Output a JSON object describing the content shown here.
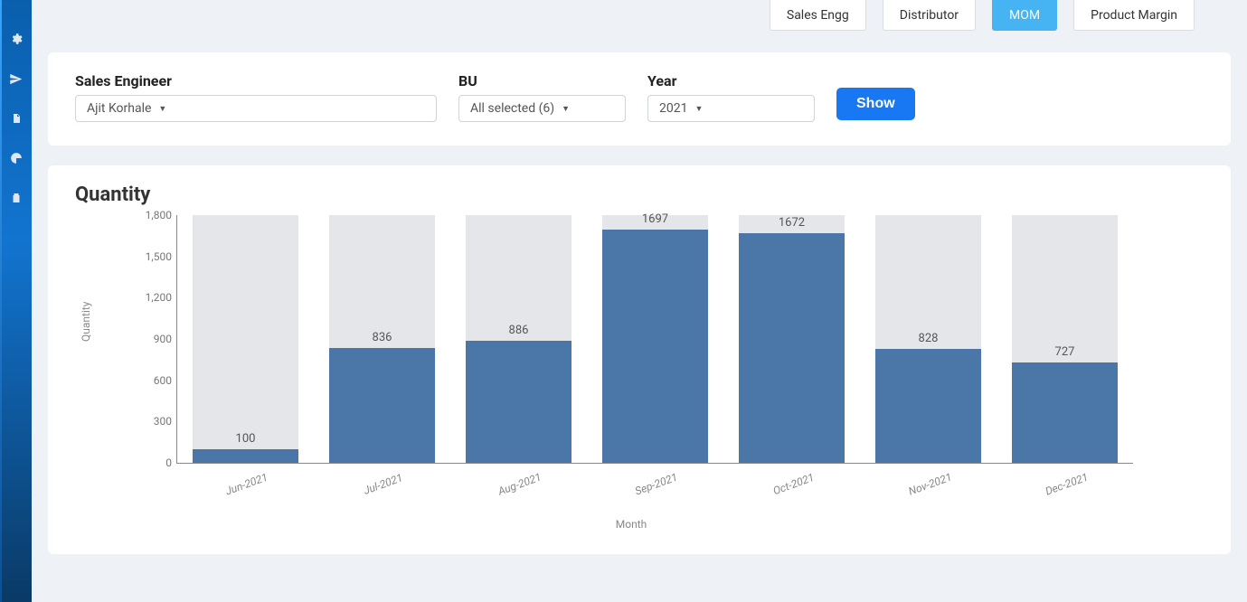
{
  "sidebar": {
    "icons": [
      "gear-icon",
      "plane-icon",
      "file-icon",
      "pie-icon",
      "clipboard-icon"
    ]
  },
  "tabs": [
    {
      "label": "Sales Engg",
      "active": false
    },
    {
      "label": "Distributor",
      "active": false
    },
    {
      "label": "MOM",
      "active": true
    },
    {
      "label": "Product Margin",
      "active": false
    }
  ],
  "filters": {
    "sales_engineer": {
      "label": "Sales Engineer",
      "value": "Ajit Korhale"
    },
    "bu": {
      "label": "BU",
      "value": "All selected (6)"
    },
    "year": {
      "label": "Year",
      "value": "2021"
    },
    "show_button": "Show"
  },
  "chart_title": "Quantity",
  "chart_data": {
    "type": "bar",
    "categories": [
      "Jun-2021",
      "Jul-2021",
      "Aug-2021",
      "Sep-2021",
      "Oct-2021",
      "Nov-2021",
      "Dec-2021"
    ],
    "values": [
      100,
      836,
      886,
      1697,
      1672,
      828,
      727
    ],
    "ylabel": "Quantity",
    "xlabel": "Month",
    "ylim": [
      0,
      1800
    ],
    "yticks": [
      0,
      300,
      600,
      900,
      1200,
      1500,
      1800
    ],
    "ytick_labels": [
      "0",
      "300",
      "600",
      "900",
      "1,200",
      "1,500",
      "1,800"
    ]
  }
}
